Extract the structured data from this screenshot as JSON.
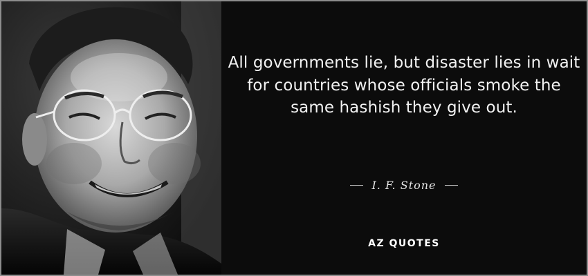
{
  "quote": {
    "text": "All governments lie, but disaster lies in wait for countries whose officials smoke the same hashish they give out."
  },
  "author": {
    "name": "I. F. Stone"
  },
  "branding": {
    "logo_text": "AZ QUOTES"
  },
  "colors": {
    "background": "#0c0c0c",
    "border": "#8d8d8d",
    "quote_text": "#f2f2f2",
    "author_text": "#e6e6e6"
  },
  "portrait": {
    "subject": "black-and-white portrait of a smiling older man wearing round glasses"
  }
}
